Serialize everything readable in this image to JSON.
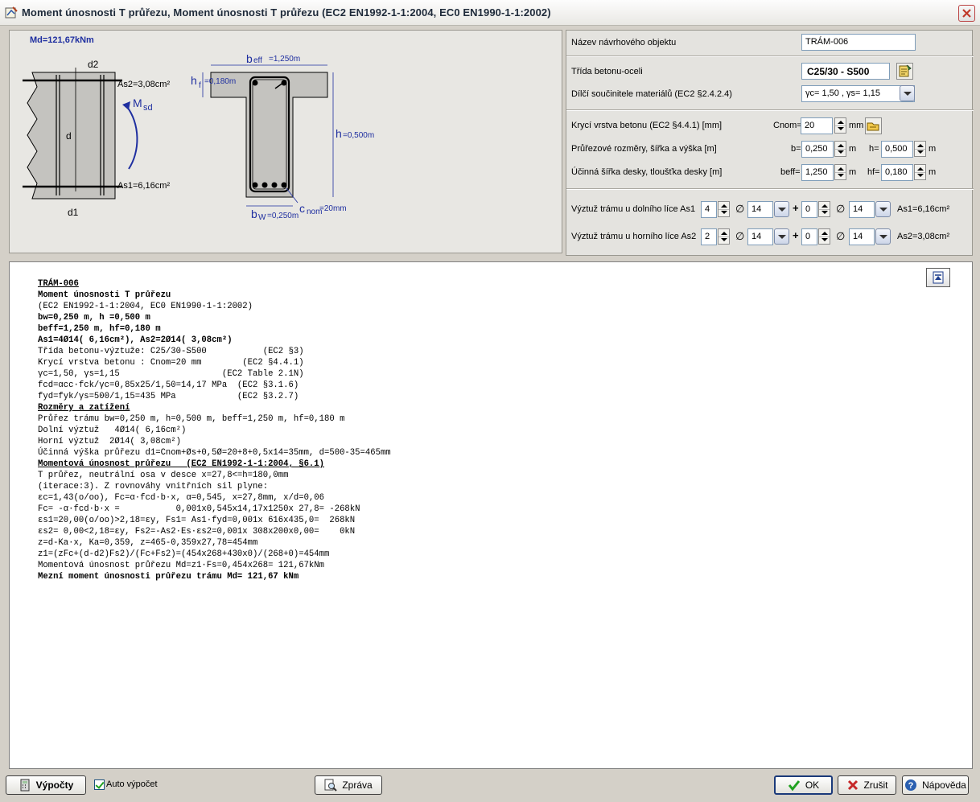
{
  "window": {
    "title": "Moment únosnosti T průřezu, Moment únosnosti T průřezu (EC2 EN1992-1-1:2004, EC0 EN1990-1-1:2002)"
  },
  "drawing": {
    "md_label": "Md=121,67kNm",
    "d2": "d2",
    "d1": "d1",
    "d": "d",
    "as2": "As2=3,08cm²",
    "as1": "As1=6,16cm²",
    "msd": "M",
    "msd_sub": "sd",
    "beff": "b",
    "beff_sub": "eff",
    "beff_val": "=1,250m",
    "hf": "h",
    "hf_sub": "f",
    "hf_val": "=0,180m",
    "h": "h",
    "h_val": "=0,500m",
    "bw": "b",
    "bw_sub": "W",
    "bw_val": "=0,250m",
    "cnom": "c",
    "cnom_sub": "nom",
    "cnom_val": "=20mm"
  },
  "form": {
    "name_label": "Název návrhového objektu",
    "name_value": "TRÁM-006",
    "class_label": "Třída betonu-oceli",
    "class_value": "C25/30 - S500",
    "factors_label": "Dílčí součinitele materiálů (EC2 §2.4.2.4)",
    "factors_value": "γc= 1,50 , γs= 1,15",
    "cover_label": "Krycí vrstva betonu (EC2 §4.4.1) [mm]",
    "cnom_label": "Cnom=",
    "cnom_value": "20",
    "mm_unit": "mm",
    "dims_label": "Průřezové rozměry, šířka a výška [m]",
    "b_label": "b=",
    "b_value": "0,250",
    "h_label": "h=",
    "h_value": "0,500",
    "m_unit": "m",
    "eff_label": "Účinná šířka desky, tloušťka desky [m]",
    "beff_label": "beff=",
    "beff_value": "1,250",
    "hf_label": "hf=",
    "hf_value": "0,180",
    "bottom_label": "Výztuž trámu u dolního líce As1",
    "bottom_n1": "4",
    "bottom_d1": "14",
    "bottom_n2": "0",
    "bottom_d2": "14",
    "bottom_as": "As1=6,16cm²",
    "top_label": "Výztuž trámu u horního líce As2",
    "top_n1": "2",
    "top_d1": "14",
    "top_n2": "0",
    "top_d2": "14",
    "top_as": "As2=3,08cm²",
    "diameter_symbol": "∅",
    "plus": "+"
  },
  "report": {
    "lines": [
      {
        "t": "TRÁM-006",
        "s": "bu"
      },
      {
        "t": "Moment únosnosti T průřezu",
        "s": "b"
      },
      {
        "t": "(EC2 EN1992-1-1:2004, EC0 EN1990-1-1:2002)",
        "s": ""
      },
      {
        "t": "bw=0,250 m, h =0,500 m",
        "s": "b"
      },
      {
        "t": "beff=1,250 m, hf=0,180 m",
        "s": "b"
      },
      {
        "t": "As1=4Ø14( 6,16cm²), As2=2Ø14( 3,08cm²)",
        "s": "b"
      },
      {
        "t": "Třída betonu-výztuže: C25/30-S500           (EC2 §3)",
        "s": ""
      },
      {
        "t": "Krycí vrstva betonu : Cnom=20 mm        (EC2 §4.4.1)",
        "s": ""
      },
      {
        "t": "γc=1,50, γs=1,15                    (EC2 Table 2.1N)",
        "s": ""
      },
      {
        "t": "fcd=αcc·fck/γc=0,85x25/1,50=14,17 MPa  (EC2 §3.1.6)",
        "s": ""
      },
      {
        "t": "fyd=fyk/γs=500/1,15=435 MPa            (EC2 §3.2.7)",
        "s": ""
      },
      {
        "t": "Rozměry a zatížení",
        "s": "bu"
      },
      {
        "t": "Průřez trámu bw=0,250 m, h=0,500 m, beff=1,250 m, hf=0,180 m",
        "s": ""
      },
      {
        "t": "Dolní výztuž   4Ø14( 6,16cm²)",
        "s": ""
      },
      {
        "t": "Horní výztuž  2Ø14( 3,08cm²)",
        "s": ""
      },
      {
        "t": "Účinná výška průřezu d1=Cnom+Øs+0,5Ø=20+8+0,5x14=35mm, d=500-35=465mm",
        "s": ""
      },
      {
        "t": "Momentová únosnost průřezu   (EC2 EN1992-1-1:2004, §6.1)",
        "s": "bu"
      },
      {
        "t": "T průřez, neutrální osa v desce x=27,8<=h=180,0mm",
        "s": ""
      },
      {
        "t": "(iterace:3). Z rovnováhy vnitřních sil plyne:",
        "s": ""
      },
      {
        "t": "εc=1,43(o/oo), Fc=α·fcd·b·x, α=0,545, x=27,8mm, x/d=0,06",
        "s": ""
      },
      {
        "t": "Fc= -α·fcd·b·x =           0,001x0,545x14,17x1250x 27,8= -268kN",
        "s": ""
      },
      {
        "t": "εs1=20,00(o/oo)>2,18=εy, Fs1= As1·fyd=0,001x 616x435,0=  268kN",
        "s": ""
      },
      {
        "t": "εs2= 0,00<2,18=εy, Fs2=-As2·Es·εs2=0,001x 308x200x0,00=    0kN",
        "s": ""
      },
      {
        "t": "z=d-Ka·x, Ka=0,359, z=465-0,359x27,78=454mm",
        "s": ""
      },
      {
        "t": "z1=(zFc+(d-d2)Fs2)/(Fc+Fs2)=(454x268+430x0)/(268+0)=454mm",
        "s": ""
      },
      {
        "t": "Momentová únosnost průřezu Md=z1·Fs=0,454x268= 121,67kNm",
        "s": ""
      },
      {
        "t": "Mezní moment únosnosti průřezu trámu Md= 121,67 kNm",
        "s": "b"
      }
    ]
  },
  "footer": {
    "calc_label": "Výpočty",
    "auto_label": "Auto výpočet",
    "report_label": "Zpráva",
    "ok_label": "OK",
    "cancel_label": "Zrušit",
    "help_label": "Nápověda"
  },
  "icons": {
    "app": "app-icon",
    "close": "close-icon",
    "concrete_library": "library-icon",
    "cover_tool": "cover-tool-icon",
    "report_scroll": "scroll-top-icon",
    "calc": "calculator-icon",
    "report": "magnifier-icon",
    "ok": "checkmark-icon",
    "cancel": "x-icon",
    "help": "question-icon"
  }
}
